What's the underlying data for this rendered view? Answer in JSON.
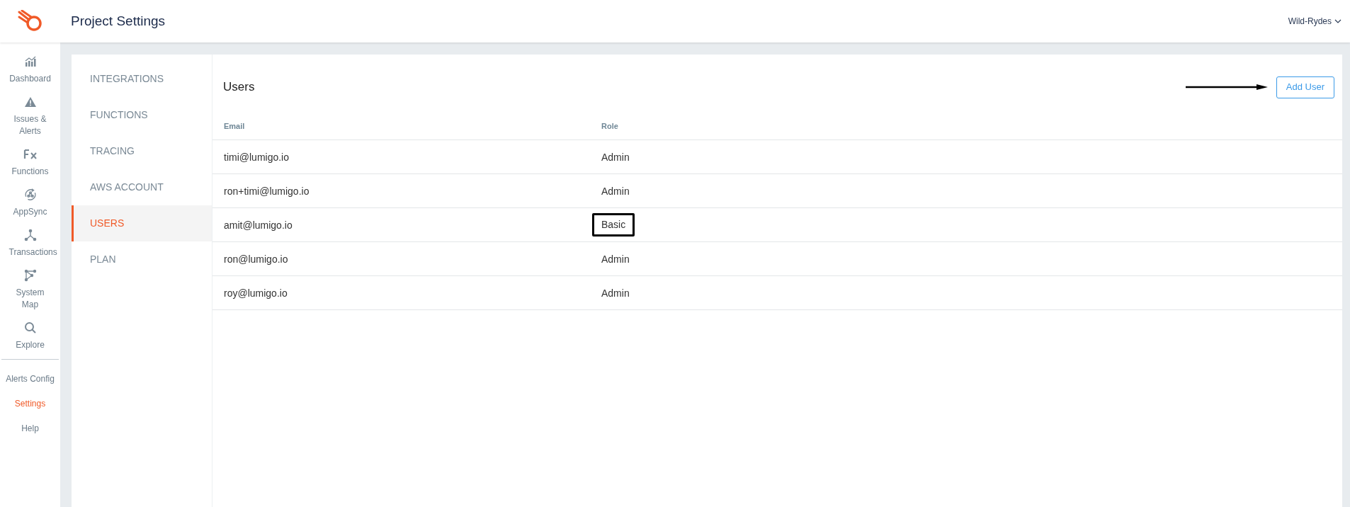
{
  "header": {
    "title": "Project Settings",
    "project": "Wild-Rydes"
  },
  "sidebar": {
    "items": [
      {
        "label": "Dashboard",
        "kind": "chart",
        "selected": false
      },
      {
        "label": "Issues & Alerts",
        "kind": "warning",
        "selected": false
      },
      {
        "label": "Functions",
        "kind": "fx",
        "selected": false
      },
      {
        "label": "AppSync",
        "kind": "sync",
        "selected": false
      },
      {
        "label": "Transactions",
        "kind": "nodes",
        "selected": false
      },
      {
        "label": "System Map",
        "kind": "map",
        "selected": false
      },
      {
        "label": "Explore",
        "kind": "search",
        "selected": false
      }
    ],
    "bottom_items": [
      {
        "label": "Alerts Config",
        "selected": false
      },
      {
        "label": "Settings",
        "selected": true
      },
      {
        "label": "Help",
        "selected": false
      }
    ]
  },
  "settings_nav": [
    {
      "label": "INTEGRATIONS",
      "selected": false
    },
    {
      "label": "FUNCTIONS",
      "selected": false
    },
    {
      "label": "TRACING",
      "selected": false
    },
    {
      "label": "AWS ACCOUNT",
      "selected": false
    },
    {
      "label": "USERS",
      "selected": true
    },
    {
      "label": "PLAN",
      "selected": false
    }
  ],
  "users": {
    "title": "Users",
    "add_button": "Add User",
    "columns": [
      "Email",
      "Role"
    ],
    "rows": [
      {
        "email": "timi@lumigo.io",
        "role": "Admin",
        "highlighted": false
      },
      {
        "email": "ron+timi@lumigo.io",
        "role": "Admin",
        "highlighted": false
      },
      {
        "email": "amit@lumigo.io",
        "role": "Basic",
        "highlighted": true
      },
      {
        "email": "ron@lumigo.io",
        "role": "Admin",
        "highlighted": false
      },
      {
        "email": "roy@lumigo.io",
        "role": "Admin",
        "highlighted": false
      }
    ]
  }
}
